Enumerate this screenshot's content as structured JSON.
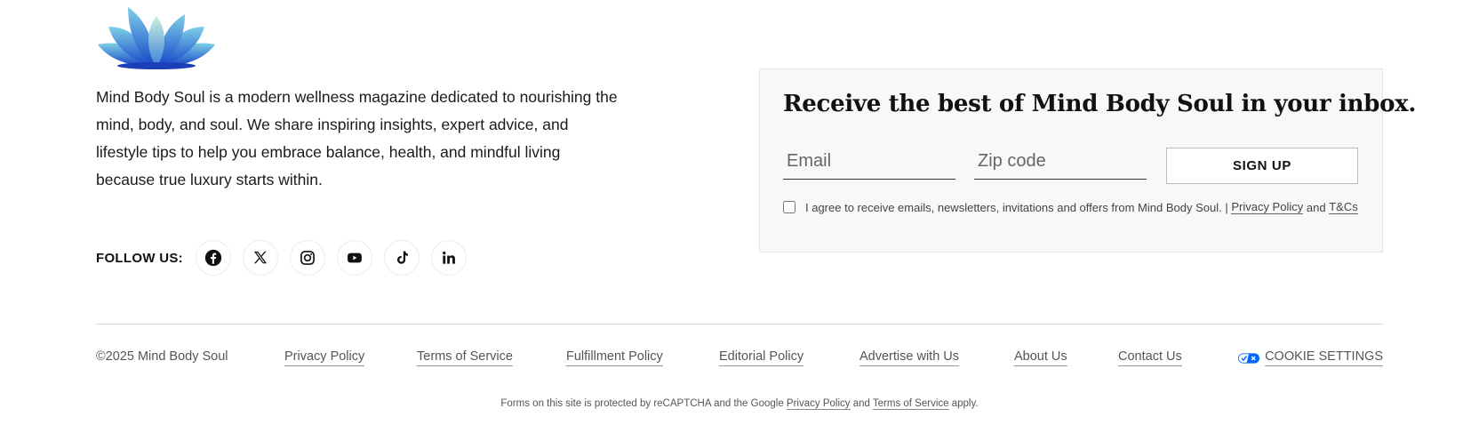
{
  "brand": {
    "logo_icon": "lotus-flower-logo",
    "accent_color": "#2b6fd6",
    "description": "Mind Body Soul is a modern wellness magazine dedicated to nourishing the mind, body, and soul. We share inspiring insights, expert advice, and lifestyle tips to help you embrace balance, health, and mindful living because true luxury starts within."
  },
  "follow": {
    "label": "FOLLOW US:",
    "networks": [
      {
        "name": "facebook",
        "icon": "facebook-icon"
      },
      {
        "name": "x",
        "icon": "x-twitter-icon"
      },
      {
        "name": "instagram",
        "icon": "instagram-icon"
      },
      {
        "name": "youtube",
        "icon": "youtube-icon"
      },
      {
        "name": "tiktok",
        "icon": "tiktok-icon"
      },
      {
        "name": "linkedin",
        "icon": "linkedin-icon"
      }
    ]
  },
  "newsletter": {
    "title": "Receive the best of Mind Body Soul in your inbox.",
    "email_placeholder": "Email",
    "email_value": "",
    "zip_placeholder": "Zip code",
    "zip_value": "",
    "signup_label": "SIGN UP",
    "consent_text": "I agree to receive emails, newsletters, invitations and offers from Mind Body Soul. |",
    "consent_privacy": "Privacy Policy",
    "consent_and": "and",
    "consent_terms": "T&Cs",
    "consent_checked": false
  },
  "bottom": {
    "copyright": "©2025 Mind Body Soul",
    "links": [
      "Privacy Policy",
      "Terms of Service",
      "Fulfillment Policy",
      "Editorial Policy",
      "Advertise with Us",
      "About Us",
      "Contact Us"
    ],
    "cookie_icon": "privacy-options-toggle-icon",
    "cookie_label": "COOKIE SETTINGS"
  },
  "recaptcha": {
    "prefix": "Forms on this site is protected by reCAPTCHA and the Google",
    "privacy": "Privacy Policy",
    "and": "and",
    "terms": "Terms of Service",
    "suffix": "apply."
  }
}
